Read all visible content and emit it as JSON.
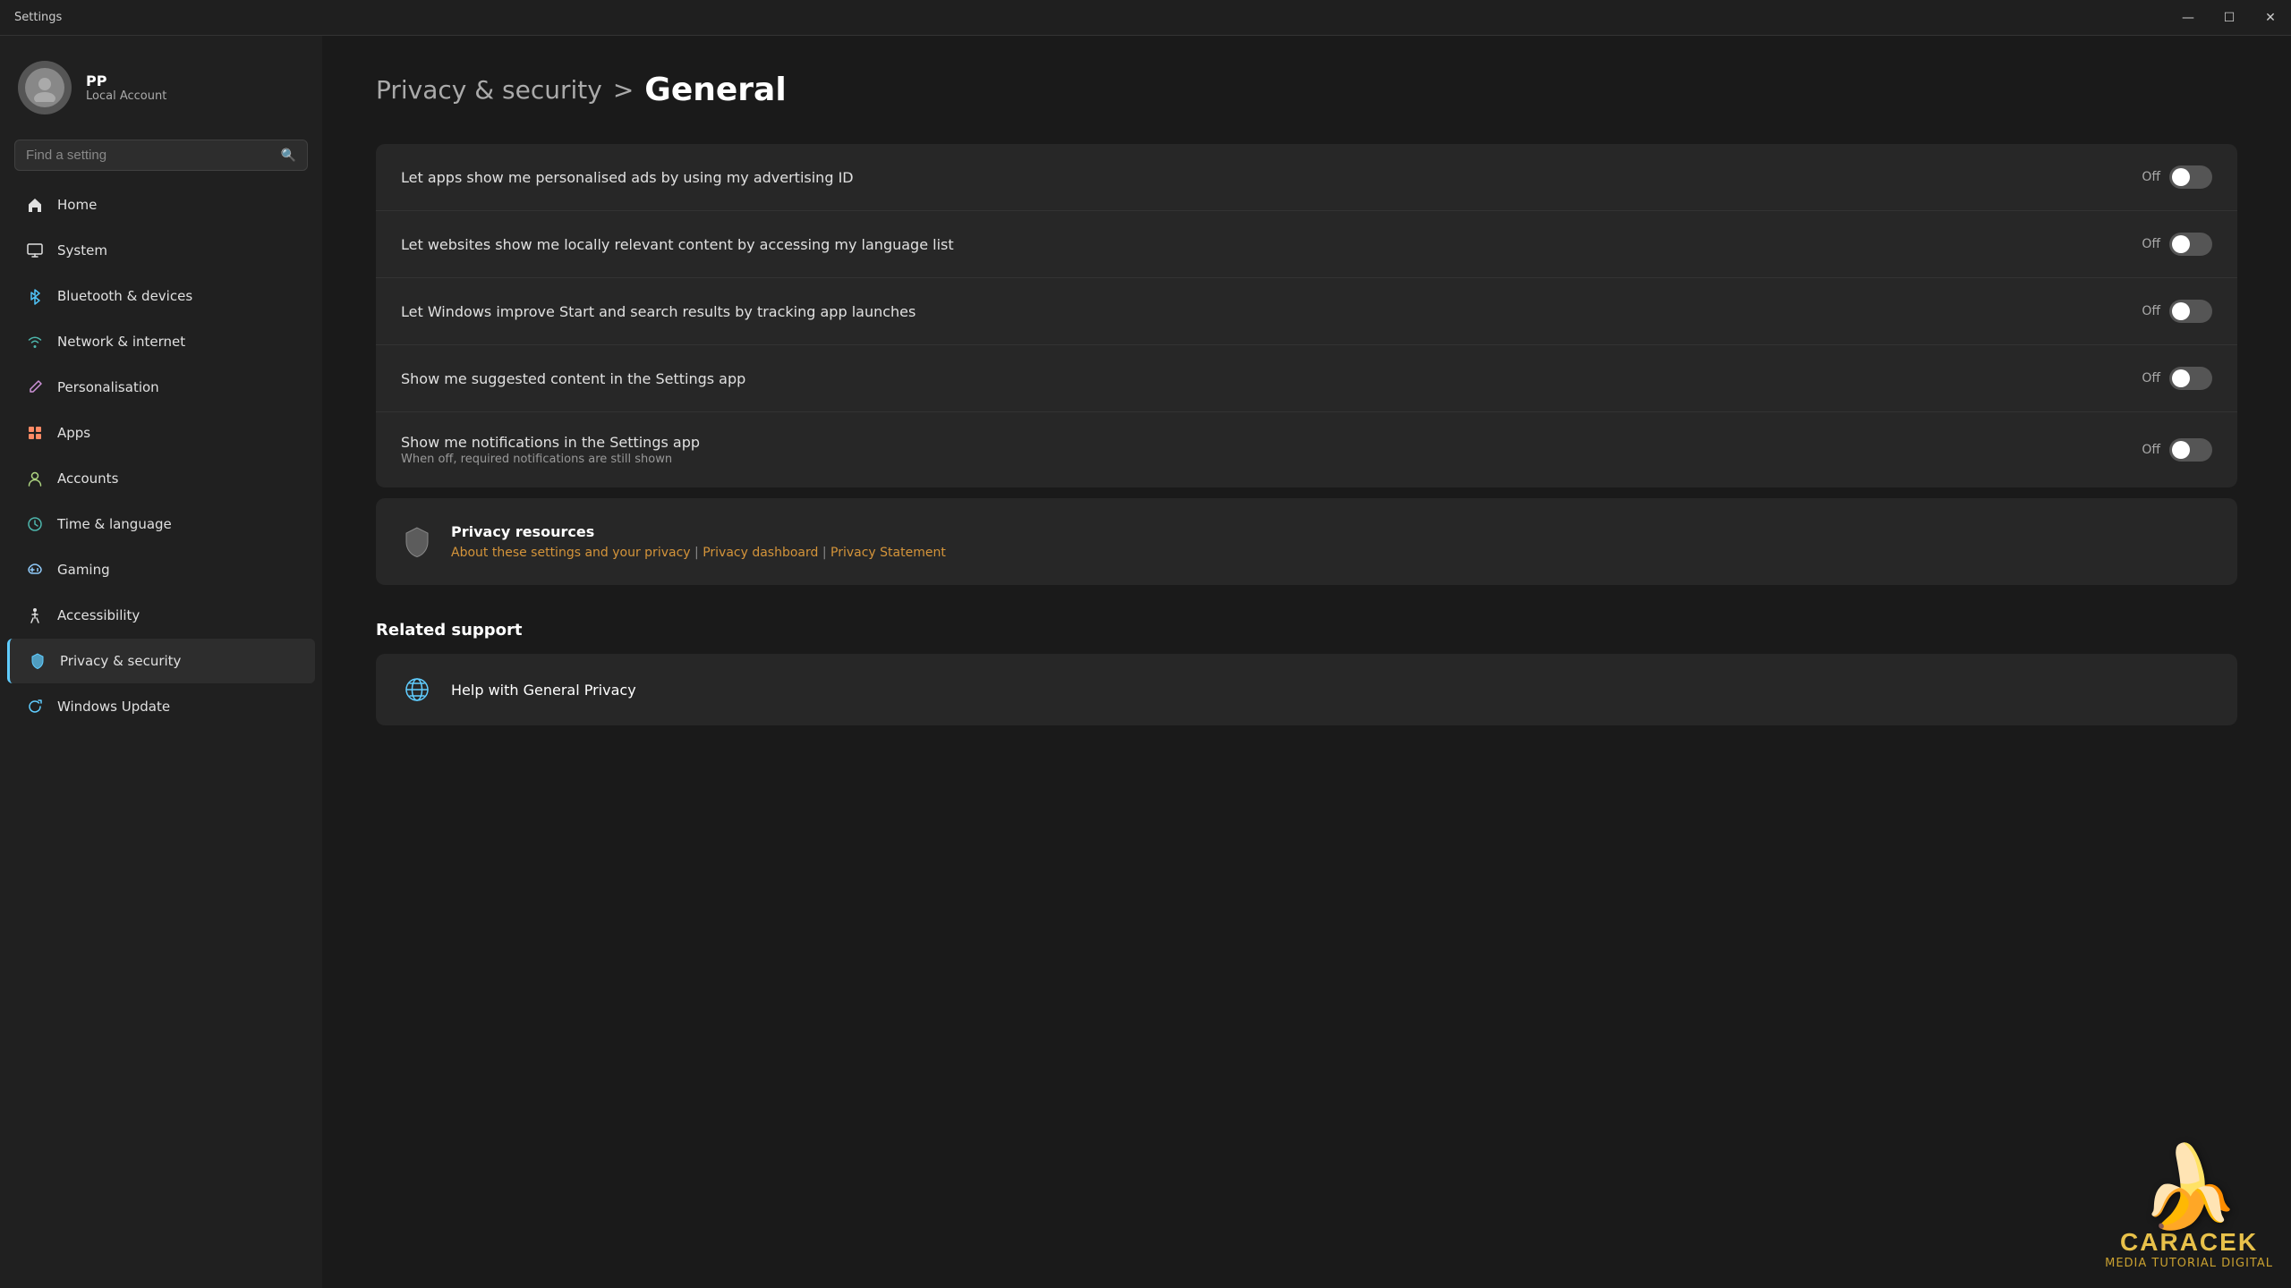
{
  "titlebar": {
    "title": "Settings",
    "controls": {
      "minimize": "—",
      "maximize": "☐",
      "close": "✕"
    }
  },
  "user": {
    "initials": "PP",
    "name": "PP",
    "account_type": "Local Account"
  },
  "search": {
    "placeholder": "Find a setting"
  },
  "nav": {
    "items": [
      {
        "id": "home",
        "label": "Home",
        "icon": "🏠"
      },
      {
        "id": "system",
        "label": "System",
        "icon": "💻"
      },
      {
        "id": "bluetooth",
        "label": "Bluetooth & devices",
        "icon": "🔵"
      },
      {
        "id": "network",
        "label": "Network & internet",
        "icon": "🌐"
      },
      {
        "id": "personalisation",
        "label": "Personalisation",
        "icon": "✏️"
      },
      {
        "id": "apps",
        "label": "Apps",
        "icon": "📦"
      },
      {
        "id": "accounts",
        "label": "Accounts",
        "icon": "👤"
      },
      {
        "id": "time",
        "label": "Time & language",
        "icon": "🕐"
      },
      {
        "id": "gaming",
        "label": "Gaming",
        "icon": "🎮"
      },
      {
        "id": "accessibility",
        "label": "Accessibility",
        "icon": "♿"
      },
      {
        "id": "privacy",
        "label": "Privacy & security",
        "icon": "🔒"
      },
      {
        "id": "update",
        "label": "Windows Update",
        "icon": "🔄"
      }
    ]
  },
  "breadcrumb": {
    "parent": "Privacy & security",
    "separator": ">",
    "current": "General"
  },
  "settings": [
    {
      "id": "ads",
      "label": "Let apps show me personalised ads by using my advertising ID",
      "sublabel": "",
      "state": "Off",
      "on": false
    },
    {
      "id": "language",
      "label": "Let websites show me locally relevant content by accessing my language list",
      "sublabel": "",
      "state": "Off",
      "on": false
    },
    {
      "id": "tracking",
      "label": "Let Windows improve Start and search results by tracking app launches",
      "sublabel": "",
      "state": "Off",
      "on": false
    },
    {
      "id": "suggested",
      "label": "Show me suggested content in the Settings app",
      "sublabel": "",
      "state": "Off",
      "on": false
    },
    {
      "id": "notifications",
      "label": "Show me notifications in the Settings app",
      "sublabel": "When off, required notifications are still shown",
      "state": "Off",
      "on": false
    }
  ],
  "privacy_resources": {
    "title": "Privacy resources",
    "links": [
      {
        "label": "About these settings and your privacy",
        "url": "#"
      },
      {
        "separator": "|"
      },
      {
        "label": "Privacy dashboard",
        "url": "#"
      },
      {
        "separator": "|"
      },
      {
        "label": "Privacy Statement",
        "url": "#"
      }
    ]
  },
  "related_support": {
    "title": "Related support",
    "items": [
      {
        "label": "Help with General Privacy"
      }
    ]
  },
  "watermark": {
    "emoji": "🍌",
    "brand": "CARACEK",
    "sub": "MEDIA TUTORIAL DIGITAL"
  }
}
